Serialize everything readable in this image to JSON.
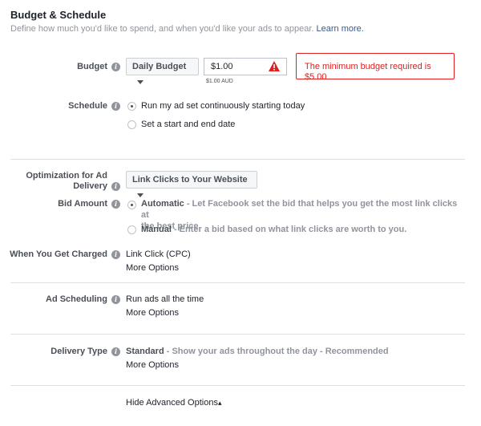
{
  "header": {
    "title": "Budget & Schedule",
    "subtitle": "Define how much you'd like to spend, and when you'd like your ads to appear.",
    "learn_more": "Learn more."
  },
  "budget": {
    "label": "Budget",
    "type_button": "Daily Budget",
    "amount_value": "$1.00",
    "amount_caption": "$1.00 AUD",
    "error": "The minimum budget required is $5.00"
  },
  "schedule": {
    "label": "Schedule",
    "options": [
      "Run my ad set continuously starting today",
      "Set a start and end date"
    ]
  },
  "optimization": {
    "label_line1": "Optimization for Ad",
    "label_line2": "Delivery",
    "button": "Link Clicks to Your Website"
  },
  "bid": {
    "label": "Bid Amount",
    "automatic_title": "Automatic",
    "automatic_desc_line1": " - Let Facebook set the bid that helps you get the most link clicks at",
    "automatic_desc_line2": "the best price.",
    "manual_title": "Manual",
    "manual_desc": " - Enter a bid based on what link clicks are worth to you."
  },
  "charged": {
    "label": "When You Get Charged",
    "value": "Link Click (CPC)",
    "more": "More Options"
  },
  "ad_scheduling": {
    "label": "Ad Scheduling",
    "value": "Run ads all the time",
    "more": "More Options"
  },
  "delivery": {
    "label": "Delivery Type",
    "value_title": "Standard",
    "value_desc": " - Show your ads throughout the day - Recommended",
    "more": "More Options"
  },
  "footer": {
    "hide_advanced": "Hide Advanced Options"
  },
  "icons": {
    "info": "i",
    "warning": "!",
    "up_caret": "▴"
  },
  "colors": {
    "link": "#365899",
    "error": "#e02020",
    "muted": "#90949c"
  }
}
